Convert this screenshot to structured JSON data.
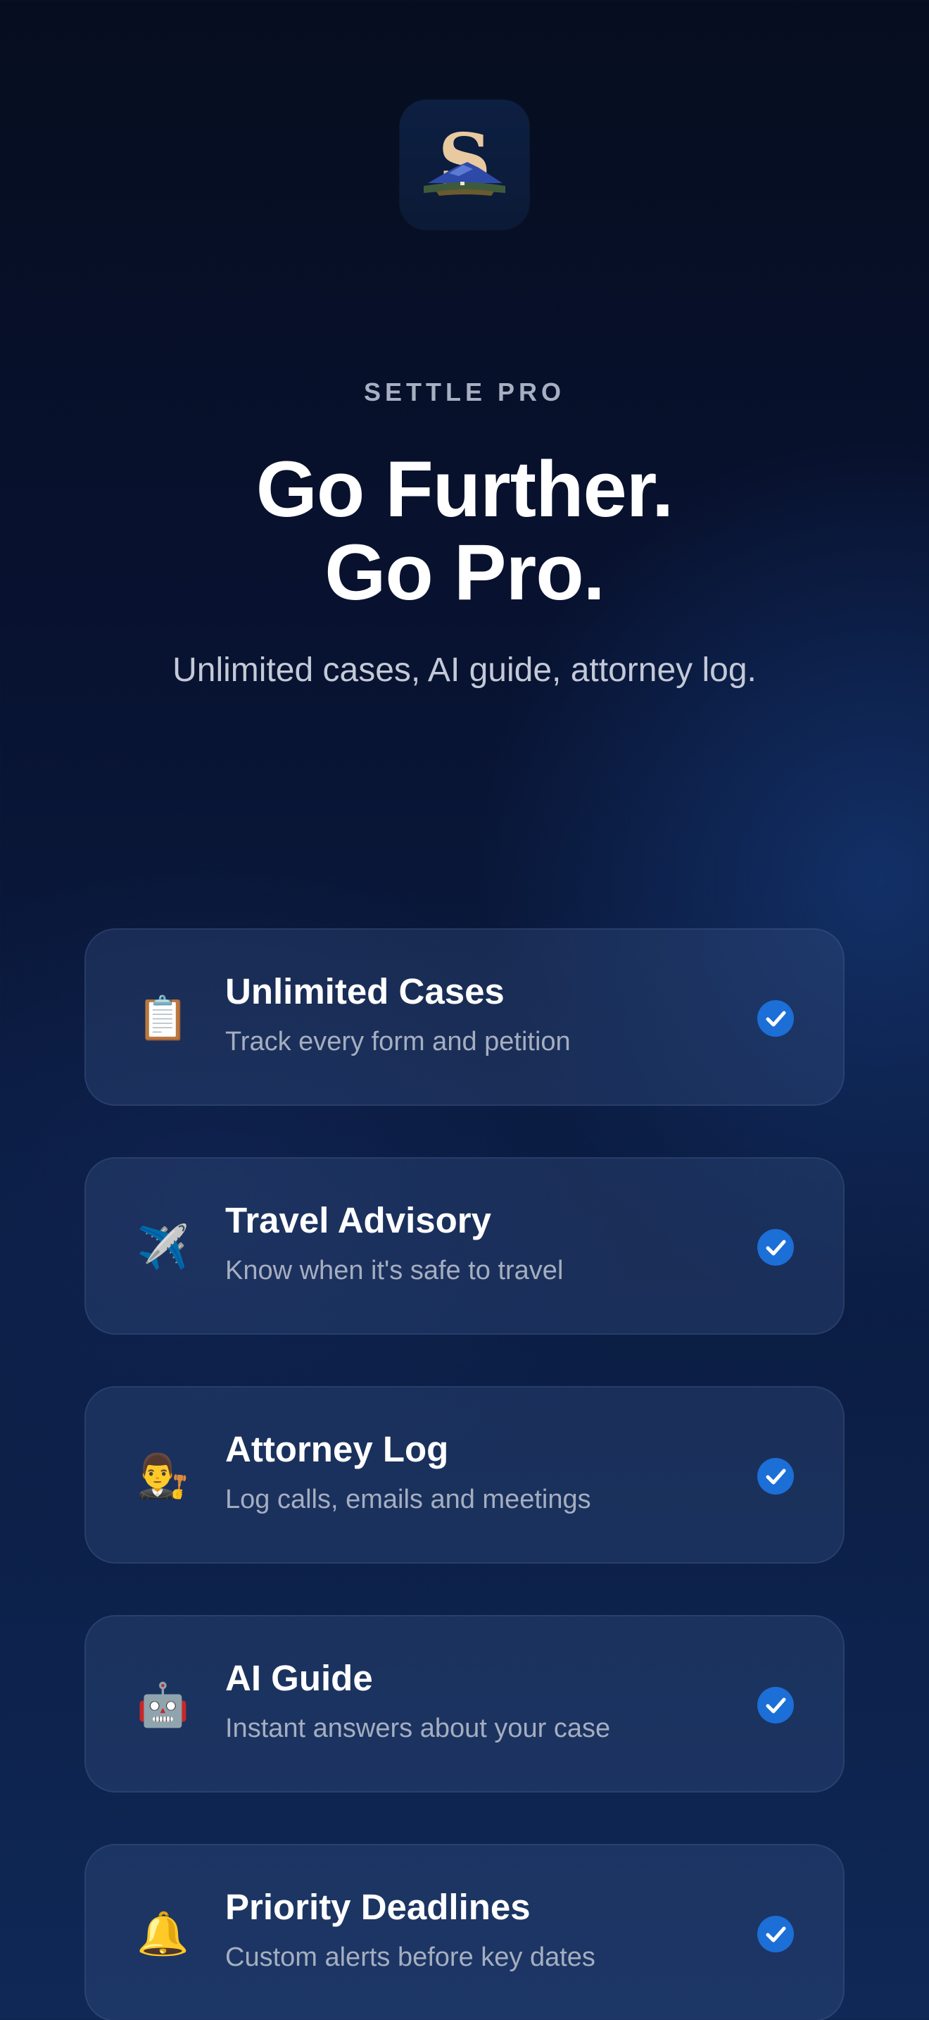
{
  "brand": {
    "eyebrow": "SETTLE PRO",
    "icon_letter": "S"
  },
  "hero": {
    "line1": "Go Further.",
    "line2": "Go Pro.",
    "subtitle": "Unlimited cases, AI guide, attorney log."
  },
  "features": [
    {
      "icon": "clipboard-icon",
      "emoji": "📋",
      "title": "Unlimited Cases",
      "desc": "Track every form and petition",
      "checked": true
    },
    {
      "icon": "airplane-icon",
      "emoji": "✈️",
      "title": "Travel Advisory",
      "desc": "Know when it's safe to travel",
      "checked": true
    },
    {
      "icon": "attorney-icon",
      "emoji": "👨‍⚖️",
      "title": "Attorney Log",
      "desc": "Log calls, emails and meetings",
      "checked": true
    },
    {
      "icon": "robot-icon",
      "emoji": "🤖",
      "title": "AI Guide",
      "desc": "Instant answers about your case",
      "checked": true
    },
    {
      "icon": "bell-icon",
      "emoji": "🔔",
      "title": "Priority Deadlines",
      "desc": "Custom alerts before key dates",
      "checked": true
    }
  ],
  "colors": {
    "accent": "#1b6fd6",
    "background_top": "#060d1f",
    "background_bottom": "#0f2856"
  }
}
